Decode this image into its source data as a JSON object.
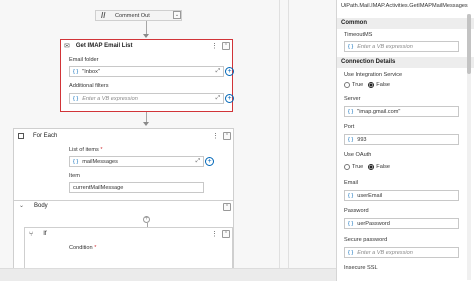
{
  "canvas": {
    "comment_out": {
      "label": "Comment Out"
    },
    "get_imap": {
      "title": "Get IMAP Email List",
      "email_folder_label": "Email folder",
      "email_folder_value": "\"Inbox\"",
      "additional_filters_label": "Additional filters",
      "additional_filters_placeholder": "Enter a VB expression"
    },
    "for_each": {
      "title": "For Each",
      "list_label": "List of items",
      "required_mark": "*",
      "list_value": "mailMessages",
      "item_label": "Item",
      "item_value": "currentMailMessage"
    },
    "body": {
      "title": "Body"
    },
    "if_block": {
      "title": "If",
      "condition_label": "Condition",
      "required_mark": "*"
    }
  },
  "properties": {
    "title": "UiPath.Mail.IMAP.Activities.GetIMAPMailMessages",
    "common_section": "Common",
    "timeout_label": "TimeoutMS",
    "timeout_placeholder": "Enter a VB expression",
    "connection_section": "Connection Details",
    "use_integration_label": "Use Integration Service",
    "use_integration_true": "True",
    "use_integration_false": "False",
    "server_label": "Server",
    "server_value": "\"imap.gmail.com\"",
    "port_label": "Port",
    "port_value": "993",
    "use_oauth_label": "Use OAuth",
    "use_oauth_true": "True",
    "use_oauth_false": "False",
    "email_label": "Email",
    "email_value": "userEmail",
    "password_label": "Password",
    "password_value": "uerPassword",
    "secure_password_label": "Secure password",
    "secure_password_placeholder": "Enter a VB expression",
    "partial_label": "Insecure SSL"
  },
  "icons": {
    "brace": "{ }",
    "expand": "⤢",
    "plus": "+",
    "kebab": "⋮",
    "collapse": "⌃"
  },
  "colors": {
    "selected_border": "#d13438",
    "accent": "#0067b8"
  }
}
